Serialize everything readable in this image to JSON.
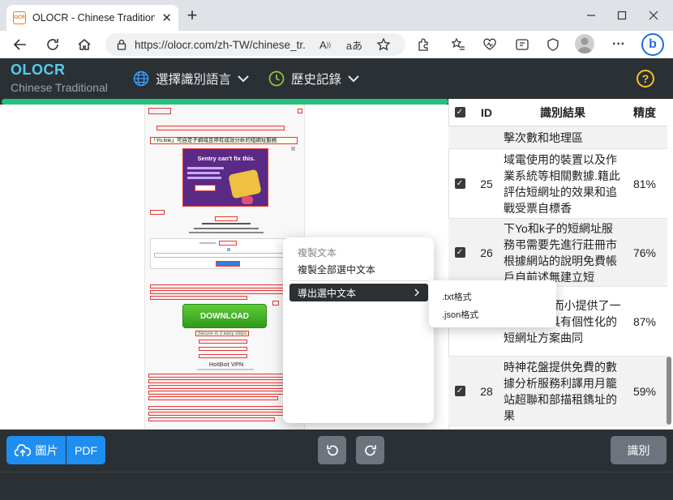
{
  "browser": {
    "tab_title": "OLOCR - Chinese Traditional OCR",
    "favicon_text": "OCR",
    "url": "https://olocr.com/zh-TW/chinese_tr..."
  },
  "app": {
    "logo": "OLOCR",
    "subtitle": "Chinese Traditional",
    "nav_language": "選擇識別語言",
    "nav_history": "歷史記錄",
    "help": "?"
  },
  "table": {
    "headers": {
      "id": "ID",
      "result": "識別結果",
      "accuracy": "精度"
    },
    "partial_row": "擊次數和地理區",
    "rows": [
      {
        "id": "25",
        "text": "域電使用的裝置以及作業系統等相關數據.籍此評估短網址的效果和追戰受票自標香",
        "pct": "81%"
      },
      {
        "id": "26",
        "text": "下Yo和k子的短網址服務弔需要先進行莊冊市根據網站的說明免費帳戶自前述無建立短",
        "pct": "76%"
      },
      {
        "id": "27",
        "text": "限製·總結而小提供了一個獨特且具有個性化的短網址方案曲同",
        "pct": "87%"
      },
      {
        "id": "28",
        "text": "時神花盤提供免費的數據分析服務利譯用月籠站超聯和部描租鐫址的果",
        "pct": "59%"
      }
    ]
  },
  "context_menu": {
    "copy_text": "複製文本",
    "copy_all": "複製全部選中文本",
    "export": "導出選中文本",
    "sub_txt": ".txt格式",
    "sub_json": ".json格式"
  },
  "bottom": {
    "image_btn": "圖片",
    "pdf_btn": "PDF",
    "recognize_btn": "識別"
  },
  "doc_preview": {
    "hl1": "「Yo.link」可自定子網域且帶有成效分析的短網址服務",
    "ad": "Sentry can't fix this.",
    "download": "DOWNLOAD",
    "secure": "Secure in 3 easy steps",
    "vpn": "HotBot VPN"
  },
  "colors": {
    "accent": "#1f8ef1",
    "progress": "#25c07c",
    "header_bg": "#2b3035",
    "logo": "#55ccee",
    "help": "#f3c424"
  }
}
